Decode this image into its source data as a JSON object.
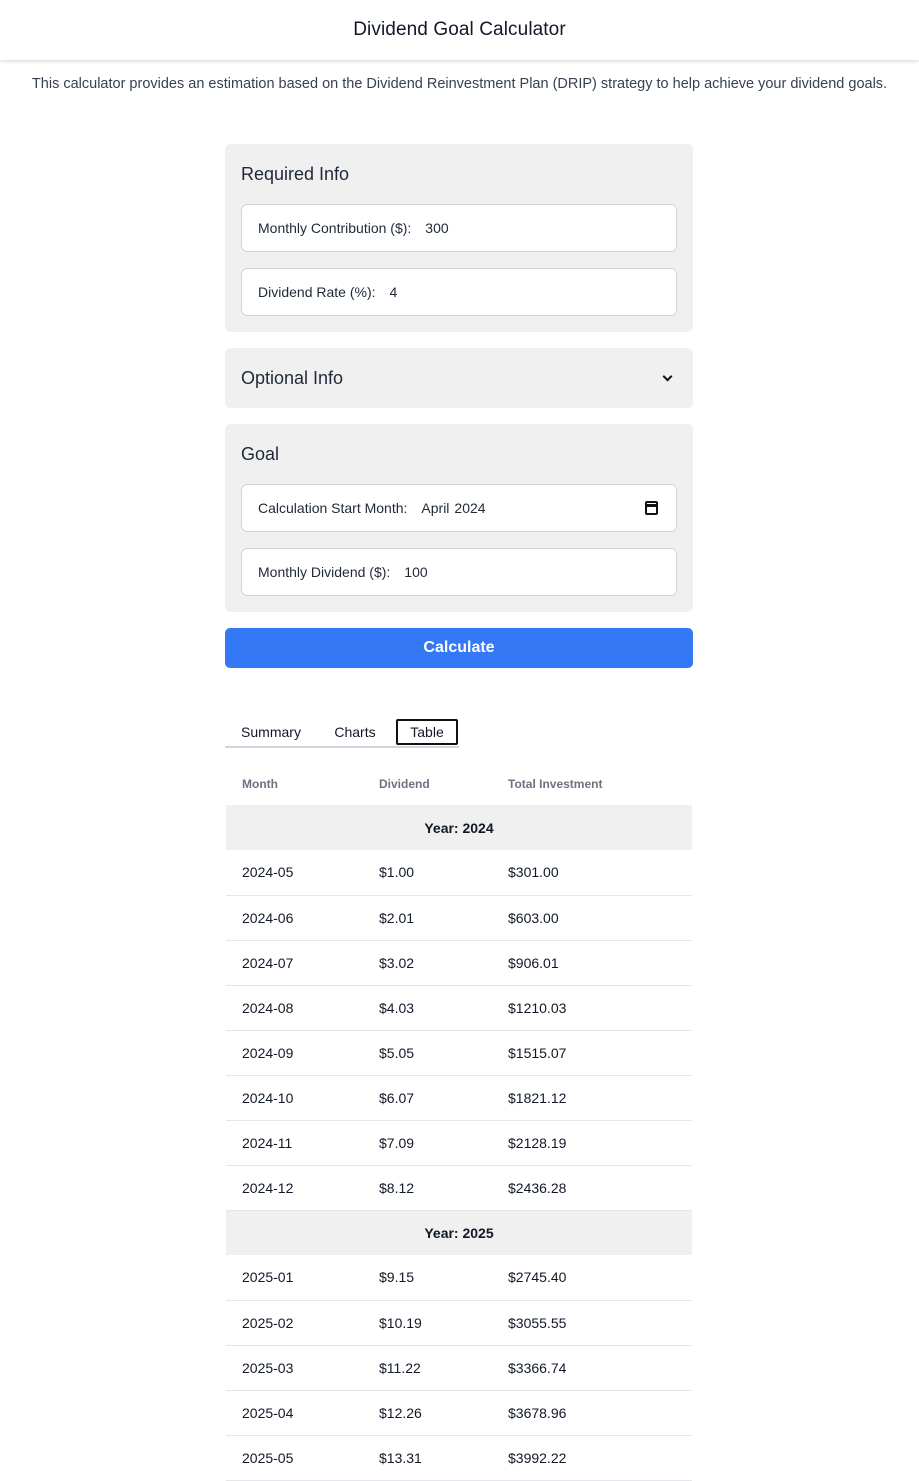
{
  "header": {
    "title": "Dividend Goal Calculator"
  },
  "intro": "This calculator provides an estimation based on the Dividend Reinvestment Plan (DRIP) strategy to help achieve your dividend goals.",
  "required": {
    "title": "Required Info",
    "monthly_contribution_label": "Monthly Contribution ($):",
    "monthly_contribution_value": "300",
    "dividend_rate_label": "Dividend Rate (%):",
    "dividend_rate_value": "4"
  },
  "optional": {
    "title": "Optional Info",
    "icon": "chevron-down-icon"
  },
  "goal": {
    "title": "Goal",
    "start_month_label": "Calculation Start Month:",
    "start_month_name": "April",
    "start_month_year": "2024",
    "monthly_dividend_label": "Monthly Dividend ($):",
    "monthly_dividend_value": "100",
    "icon": "calendar-icon"
  },
  "calculate_label": "Calculate",
  "tabs": [
    {
      "label": "Summary",
      "active": false
    },
    {
      "label": "Charts",
      "active": false
    },
    {
      "label": "Table",
      "active": true
    }
  ],
  "table": {
    "headers": [
      "Month",
      "Dividend",
      "Total Investment"
    ],
    "rows": [
      {
        "type": "year",
        "label": "Year: 2024"
      },
      {
        "type": "row",
        "month": "2024-05",
        "dividend": "$1.00",
        "total": "$301.00"
      },
      {
        "type": "row",
        "month": "2024-06",
        "dividend": "$2.01",
        "total": "$603.00"
      },
      {
        "type": "row",
        "month": "2024-07",
        "dividend": "$3.02",
        "total": "$906.01"
      },
      {
        "type": "row",
        "month": "2024-08",
        "dividend": "$4.03",
        "total": "$1210.03"
      },
      {
        "type": "row",
        "month": "2024-09",
        "dividend": "$5.05",
        "total": "$1515.07"
      },
      {
        "type": "row",
        "month": "2024-10",
        "dividend": "$6.07",
        "total": "$1821.12"
      },
      {
        "type": "row",
        "month": "2024-11",
        "dividend": "$7.09",
        "total": "$2128.19"
      },
      {
        "type": "row",
        "month": "2024-12",
        "dividend": "$8.12",
        "total": "$2436.28"
      },
      {
        "type": "year",
        "label": "Year: 2025"
      },
      {
        "type": "row",
        "month": "2025-01",
        "dividend": "$9.15",
        "total": "$2745.40"
      },
      {
        "type": "row",
        "month": "2025-02",
        "dividend": "$10.19",
        "total": "$3055.55"
      },
      {
        "type": "row",
        "month": "2025-03",
        "dividend": "$11.22",
        "total": "$3366.74"
      },
      {
        "type": "row",
        "month": "2025-04",
        "dividend": "$12.26",
        "total": "$3678.96"
      },
      {
        "type": "row",
        "month": "2025-05",
        "dividend": "$13.31",
        "total": "$3992.22"
      }
    ]
  }
}
